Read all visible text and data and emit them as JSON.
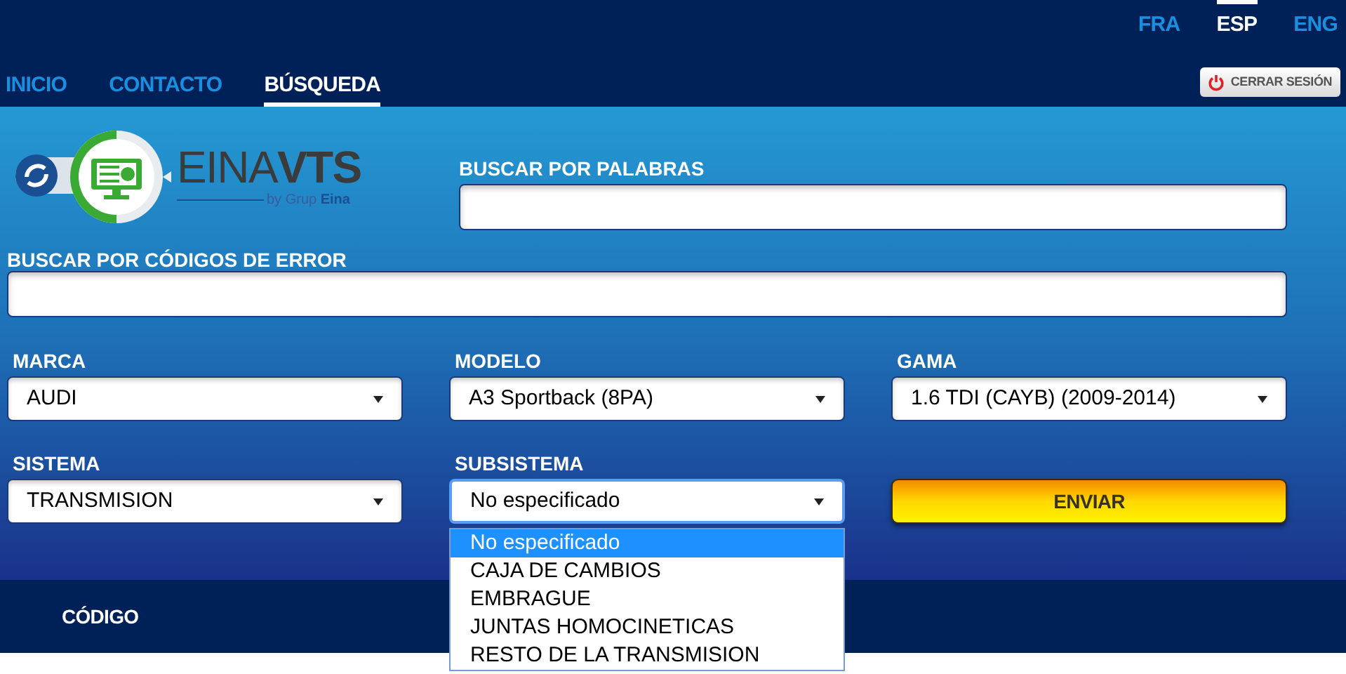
{
  "languages": [
    {
      "label": "FRA",
      "selected": false
    },
    {
      "label": "ESP",
      "selected": true
    },
    {
      "label": "ENG",
      "selected": false
    }
  ],
  "nav": [
    {
      "label": "INICIO",
      "selected": false
    },
    {
      "label": "CONTACTO",
      "selected": false
    },
    {
      "label": "BÚSQUEDA",
      "selected": true
    }
  ],
  "logout_button": "CERRAR SESIÓN",
  "logo": {
    "name_light": "EINA",
    "name_bold": "VTS",
    "tagline_light": "by Grup",
    "tagline_bold": "Eina"
  },
  "search_words": {
    "label": "BUSCAR POR PALABRAS"
  },
  "search_codes": {
    "label": "BUSCAR POR CÓDIGOS DE ERROR"
  },
  "selects": [
    {
      "label": "MARCA",
      "value": "AUDI",
      "open": false
    },
    {
      "label": "MODELO",
      "value": "A3 Sportback (8PA)",
      "open": false
    },
    {
      "label": "GAMA",
      "value": "1.6 TDI (CAYB) (2009-2014)",
      "open": false
    },
    {
      "label": "SISTEMA",
      "value": "TRANSMISION",
      "open": false
    },
    {
      "label": "SUBSISTEMA",
      "value": "No especificado",
      "open": true,
      "options": [
        {
          "label": "No especificado",
          "selected": true
        },
        {
          "label": "CAJA DE CAMBIOS",
          "selected": false
        },
        {
          "label": "EMBRAGUE",
          "selected": false
        },
        {
          "label": "JUNTAS HOMOCINETICAS",
          "selected": false
        },
        {
          "label": "RESTO DE LA TRANSMISION",
          "selected": false
        }
      ]
    }
  ],
  "submit_button": "ENVIAR",
  "results_header": {
    "column_1": "CÓDIGO"
  }
}
